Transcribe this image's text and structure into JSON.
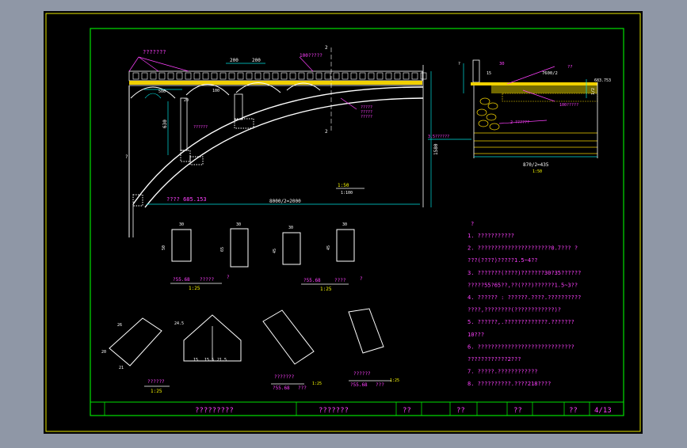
{
  "drawing": {
    "elevation": {
      "top_label": "???????",
      "right_top_label": "100?????",
      "dim_200a": "200",
      "dim_200b": "200",
      "dim_100": "100",
      "dim_500": "500",
      "dim_630": "630",
      "dim_1580": "1580",
      "span_label": "8000/2=2000",
      "elevation_label": "???? 685.153",
      "section_mark_top": "2",
      "section_mark_bottom": "2",
      "scale_label": "1:50",
      "scale_sub": "1:100",
      "right_note_a": "?????",
      "right_note_b": "?????",
      "right_note_c": "?????",
      "left_mark": "?",
      "small_a": "??????",
      "small_b": "20"
    },
    "section": {
      "label_a": "7600/2",
      "label_b": "??",
      "label_c": "683.753",
      "label_d": "1/2",
      "label_e": "100?????",
      "label_f": "2 ??????",
      "label_g": "3.5??????",
      "bottom_dim": "870/2=435",
      "scale_label": "1:50",
      "dim_30": "30",
      "dim_15": "15",
      "dim_tt": "?"
    },
    "blocks": {
      "dims": [
        "30",
        "30",
        "30",
        "30"
      ],
      "heights": [
        "50",
        "65",
        "45",
        "45"
      ],
      "caption1_a": "?55.68",
      "caption1_b": "?????",
      "caption1_c": "1:25",
      "caption1_q": "?",
      "caption2_a": "?55.68",
      "caption2_b": "????",
      "caption2_c": "1:25",
      "caption2_q": "?"
    },
    "voussoirs": {
      "caption_a": "??????",
      "caption_b": "1:25",
      "caption_c": "???????",
      "caption_d": "?55.68",
      "caption_e": "???",
      "caption_f": "1:25",
      "caption_g": "??????",
      "caption_h": "?55.68",
      "caption_i": "???",
      "caption_j": "1:25",
      "dim_a": "26",
      "dim_b": "20",
      "dim_c": "21",
      "dim_d": "15",
      "dim_e": "24.5",
      "dim_f": "15.5",
      "dim_g": "21.5"
    },
    "notes": {
      "header": "?",
      "lines": [
        "1. ???????????",
        "2. ??????????????????????0.7???  ?",
        "   ???(????)?????1.5~4??",
        "3. ???????(????)???????30?35??????",
        "   ?????55?65??,??(???)??????1.5~3??",
        "4. ??????  :  ??????.????.??????????",
        "   ????,????????(????????????)?",
        "5. ??????,.?????????????.???????",
        "   10???",
        "6. ?????????????????????????????",
        "   ????????????2???",
        "7. ?????.????????????",
        "8. ??????????.????218????"
      ]
    },
    "title_block": {
      "cells": [
        "?????????",
        "???????",
        "??",
        "??",
        "??",
        "??",
        "4/13"
      ]
    }
  }
}
